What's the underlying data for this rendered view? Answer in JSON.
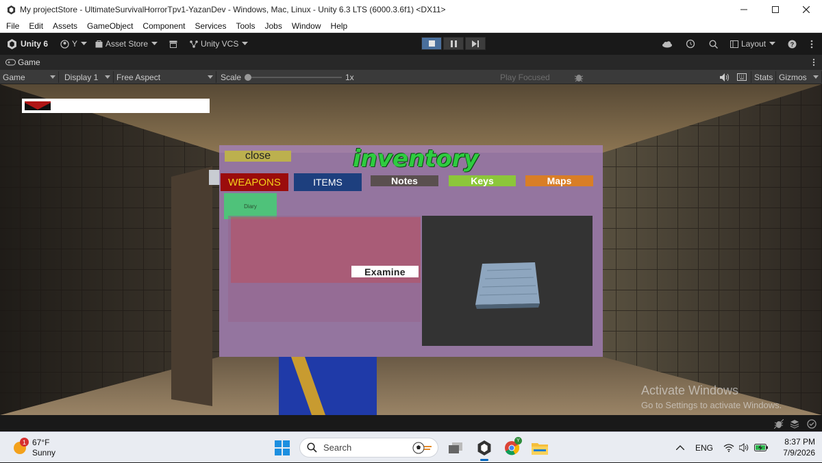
{
  "window": {
    "title": "My projectStore - UltimateSurvivalHorrorTpv1-YazanDev - Windows, Mac, Linux - Unity 6.3 LTS (6000.3.6f1) <DX11>"
  },
  "menu": [
    "File",
    "Edit",
    "Assets",
    "GameObject",
    "Component",
    "Services",
    "Tools",
    "Jobs",
    "Window",
    "Help"
  ],
  "toolbar": {
    "unity_label": "Unity 6",
    "account_label": "Y",
    "asset_store_label": "Asset Store",
    "vcs_label": "Unity VCS",
    "layout_label": "Layout"
  },
  "tab": {
    "label": "Game"
  },
  "game_bar": {
    "mode": "Game",
    "display": "Display 1",
    "aspect": "Free Aspect",
    "scale_label": "Scale",
    "scale_value": "1x",
    "scale_fraction": 0.0,
    "play_focused": "Play Focused",
    "stats": "Stats",
    "gizmos": "Gizmos"
  },
  "inventory": {
    "title": "inventory",
    "close": "close",
    "tabs": {
      "weapons": "WEAPONS",
      "items": "ITEMS",
      "notes": "Notes",
      "keys": "Keys",
      "maps": "Maps",
      "diary": "Diary"
    },
    "examine": "Examine",
    "colors": {
      "weapons": "#9b0c0c",
      "items": "#1d3f7e",
      "notes": "#5a4f4f",
      "keys": "#8cc63a",
      "maps": "#d97e26",
      "diary": "#4fc27a",
      "close": "#bcb04e",
      "title": "#2ecc40"
    }
  },
  "watermark": {
    "line1": "Activate Windows",
    "line2": "Go to Settings to activate Windows."
  },
  "taskbar": {
    "weather_temp": "67°F",
    "weather_desc": "Sunny",
    "weather_badge": "1",
    "search_label": "Search",
    "lang": "ENG",
    "time": "8:37 PM",
    "date": "7/9/2026"
  }
}
